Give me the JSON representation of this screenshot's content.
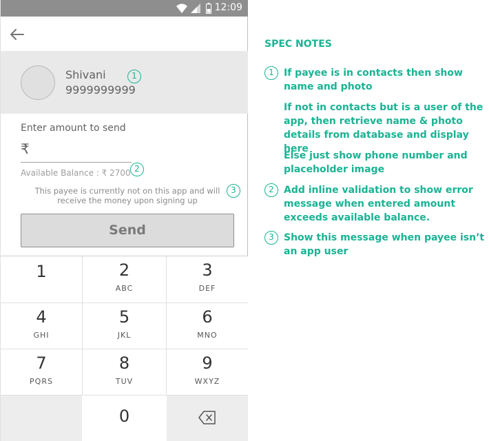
{
  "status_bar": {
    "time": "12:09"
  },
  "payee": {
    "name": "Shivani",
    "phone": "9999999999"
  },
  "amount": {
    "label": "Enter amount to send",
    "currency_symbol": "₹",
    "value": "",
    "balance_text": "Available Balance : ₹ 2700"
  },
  "payee_note": "This payee is currently not on this app and will receive the money upon signing up",
  "send_button": {
    "label": "Send"
  },
  "keypad": {
    "keys": [
      {
        "digit": "1",
        "letters": ""
      },
      {
        "digit": "2",
        "letters": "ABC"
      },
      {
        "digit": "3",
        "letters": "DEF"
      },
      {
        "digit": "4",
        "letters": "GHI"
      },
      {
        "digit": "5",
        "letters": "JKL"
      },
      {
        "digit": "6",
        "letters": "MNO"
      },
      {
        "digit": "7",
        "letters": "PQRS"
      },
      {
        "digit": "8",
        "letters": "TUV"
      },
      {
        "digit": "9",
        "letters": "WXYZ"
      },
      {
        "digit": "0",
        "letters": ""
      }
    ]
  },
  "markers": {
    "m1": "1",
    "m2": "2",
    "m3": "3"
  },
  "spec": {
    "title": "SPEC NOTES",
    "notes": [
      {
        "marker": "1",
        "text": "If payee is in contacts then show name and photo"
      },
      {
        "marker": "",
        "text": "If not in contacts but is a user of the app, then retrieve name & photo details from database and display here"
      },
      {
        "marker": "",
        "text": "Else just show phone number and placeholder image"
      },
      {
        "marker": "2",
        "text": "Add inline validation to show error message when entered amount exceeds available balance."
      },
      {
        "marker": "3",
        "text": "Show this message when payee isn’t an app user"
      }
    ]
  },
  "colors": {
    "accent": "#1ab394",
    "status_bar": "#8e8e8e",
    "payee_bg": "#e9e9e9"
  }
}
